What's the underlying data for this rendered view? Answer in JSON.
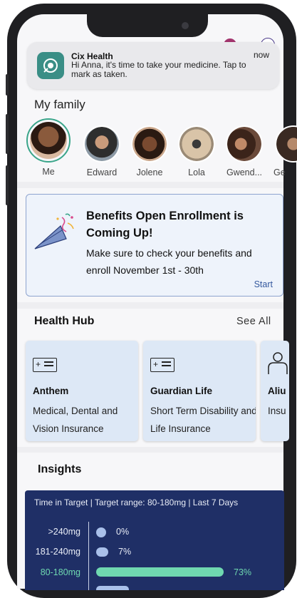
{
  "notification": {
    "app_name": "Cix Health",
    "time": "now",
    "message": "Hi Anna, it's time to take your medicine. Tap to mark as taken."
  },
  "family": {
    "title": "My family",
    "members": [
      {
        "label": "Me",
        "selected": true
      },
      {
        "label": "Edward",
        "selected": false
      },
      {
        "label": "Jolene",
        "selected": false
      },
      {
        "label": "Lola",
        "selected": false
      },
      {
        "label": "Gwend...",
        "selected": false
      },
      {
        "label": "Ge",
        "selected": false
      }
    ]
  },
  "enrollment": {
    "title": "Benefits Open Enrollment is Coming Up!",
    "body": "Make sure to check your benefits and enroll November 1st - 30th",
    "action": "Start",
    "icon": "party-horn-icon"
  },
  "health_hub": {
    "title": "Health Hub",
    "see_all": "See All",
    "cards": [
      {
        "name": "Anthem",
        "description": "Medical, Dental and Vision Insurance",
        "icon": "insurance-card-icon"
      },
      {
        "name": "Guardian Life",
        "description": "Short Term Disability and Life Insurance",
        "icon": "insurance-card-icon"
      },
      {
        "name": "Aliu",
        "description": "Insu",
        "icon": "person-icon"
      }
    ]
  },
  "insights": {
    "title": "Insights",
    "header": "Time in Target  |  Target range: 80-180mg  |  Last 7 Days",
    "rows": [
      {
        "label": ">240mg",
        "percent": 0,
        "value": "0%",
        "color": "#a9c0ea"
      },
      {
        "label": "181-240mg",
        "percent": 7,
        "value": "7%",
        "color": "#a9c0ea"
      },
      {
        "label": "80-180mg",
        "percent": 73,
        "value": "73%",
        "color": "#6fd8b0",
        "target": true
      }
    ]
  },
  "colors": {
    "accent_green": "#3aa58a",
    "panel_navy": "#1f2f66",
    "link_blue": "#34589e"
  }
}
